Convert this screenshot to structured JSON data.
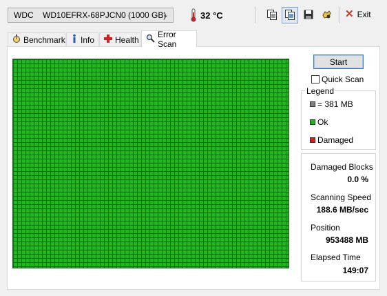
{
  "drive": {
    "vendor": "WDC",
    "model": "WD10EFRX-68PJCN0 (1000 GB)",
    "temperature": "32 °C"
  },
  "toolbar": {
    "exit_label": "Exit"
  },
  "tabs": [
    {
      "label": "Benchmark",
      "icon": "stopwatch-icon"
    },
    {
      "label": "Info",
      "icon": "info-icon"
    },
    {
      "label": "Health",
      "icon": "health-cross-icon"
    },
    {
      "label": "Error Scan",
      "icon": "magnifier-icon"
    }
  ],
  "active_tab": "Error Scan",
  "controls": {
    "start_label": "Start",
    "quick_scan_label": "Quick Scan",
    "quick_scan_checked": false
  },
  "legend": {
    "title": "Legend",
    "block_size": "= 381 MB",
    "ok": "Ok",
    "damaged": "Damaged",
    "colors": {
      "block": "#7f7f7f",
      "ok": "#1db81d",
      "damaged": "#d42020"
    }
  },
  "stats": {
    "damaged_blocks_label": "Damaged Blocks",
    "damaged_blocks_value": "0.0 %",
    "speed_label": "Scanning Speed",
    "speed_value": "188.6 MB/sec",
    "position_label": "Position",
    "position_value": "953488 MB",
    "elapsed_label": "Elapsed Time",
    "elapsed_value": "149:07"
  }
}
